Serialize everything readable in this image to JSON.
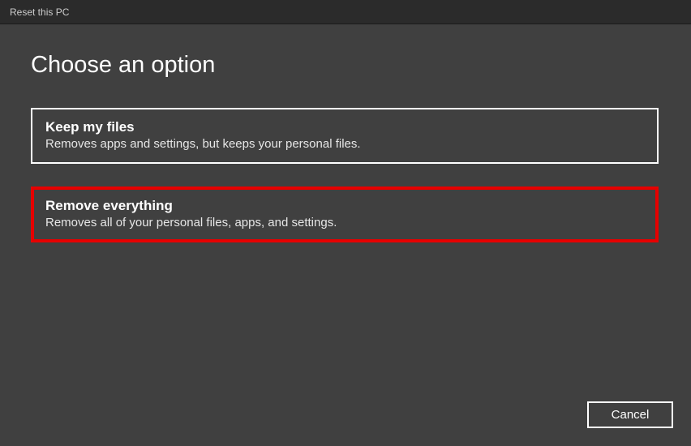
{
  "window": {
    "title": "Reset this PC"
  },
  "heading": "Choose an option",
  "options": [
    {
      "title": "Keep my files",
      "description": "Removes apps and settings, but keeps your personal files.",
      "highlighted": false
    },
    {
      "title": "Remove everything",
      "description": "Removes all of your personal files, apps, and settings.",
      "highlighted": true
    }
  ],
  "footer": {
    "cancel_label": "Cancel"
  },
  "colors": {
    "background": "#404040",
    "titlebar": "#2b2b2b",
    "highlight_border": "#e60000",
    "text": "#ffffff"
  }
}
